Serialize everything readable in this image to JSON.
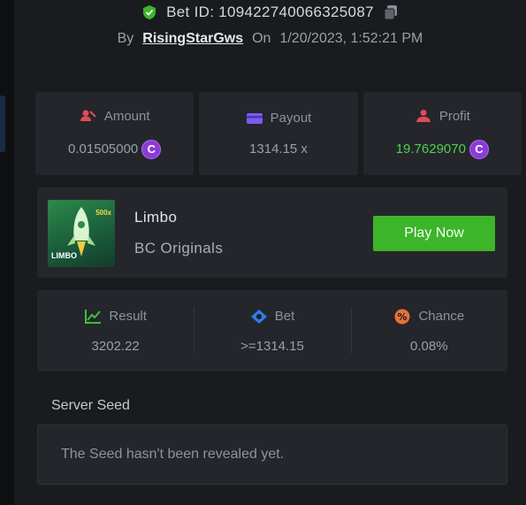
{
  "bet": {
    "id_text": "Bet ID: 109422740066325087",
    "by_label": "By",
    "username": "RisingStarGws",
    "on_label": "On",
    "datetime": "1/20/2023, 1:52:21 PM"
  },
  "stats": {
    "amount": {
      "label": "Amount",
      "value": "0.01505000",
      "icon": "amount-icon"
    },
    "payout": {
      "label": "Payout",
      "value": "1314.15 x",
      "icon": "wallet-icon"
    },
    "profit": {
      "label": "Profit",
      "value": "19.7629070",
      "icon": "profit-icon"
    }
  },
  "game": {
    "name": "Limbo",
    "provider": "BC Originals",
    "thumb_label": "LIMBO",
    "thumb_badge": "500x",
    "play_label": "Play Now"
  },
  "results": {
    "result": {
      "label": "Result",
      "value": "3202.22"
    },
    "bet": {
      "label": "Bet",
      "value": ">=1314.15"
    },
    "chance": {
      "label": "Chance",
      "value": "0.08%"
    }
  },
  "seed": {
    "label": "Server Seed",
    "message": "The Seed hasn't been revealed yet."
  },
  "colors": {
    "accent_green": "#3cb52a",
    "profit_green": "#4cd14e",
    "coin_purple": "#8b3bd9",
    "amount_red": "#e04a5a",
    "payout_purple": "#7a5cf0",
    "result_green": "#3fbf3f",
    "bet_blue": "#2e7be6",
    "chance_orange": "#e8713a"
  },
  "coin_symbol": "C"
}
